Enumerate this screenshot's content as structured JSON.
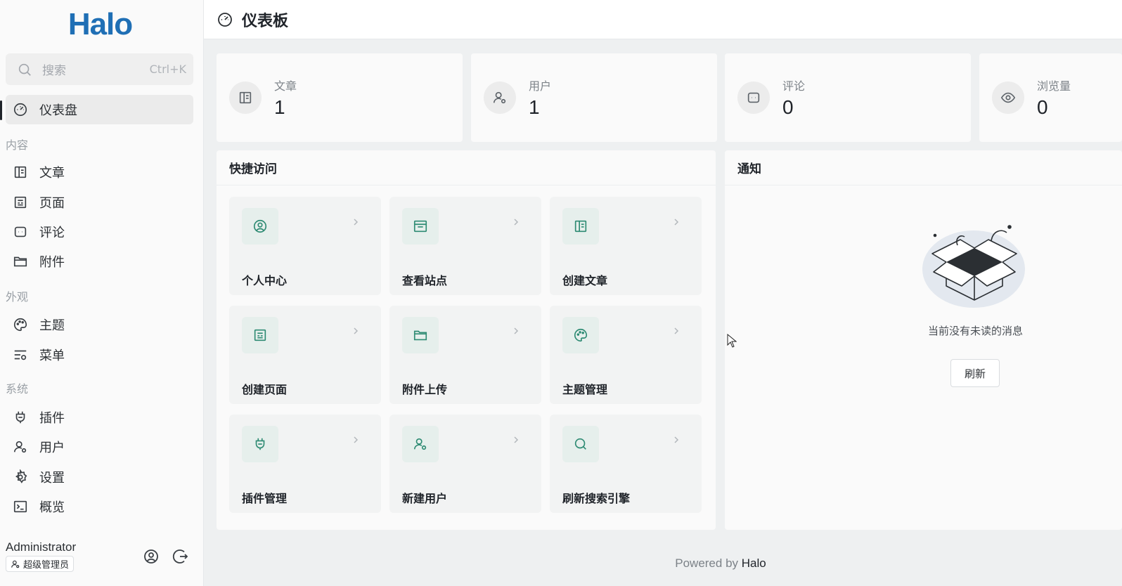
{
  "app": {
    "logo": "Halo"
  },
  "search": {
    "placeholder": "搜索",
    "shortcut": "Ctrl+K"
  },
  "sidebar": {
    "dashboard": {
      "label": "仪表盘",
      "icon": "dashboard-icon"
    },
    "sections": {
      "content": "内容",
      "appearance": "外观",
      "system": "系统"
    },
    "items": [
      {
        "label": "文章",
        "icon": "posts-icon"
      },
      {
        "label": "页面",
        "icon": "pages-icon"
      },
      {
        "label": "评论",
        "icon": "comments-icon"
      },
      {
        "label": "附件",
        "icon": "folder-icon"
      },
      {
        "label": "主题",
        "icon": "palette-icon"
      },
      {
        "label": "菜单",
        "icon": "menu-settings-icon"
      },
      {
        "label": "插件",
        "icon": "plug-icon"
      },
      {
        "label": "用户",
        "icon": "user-icon"
      },
      {
        "label": "设置",
        "icon": "gear-icon"
      },
      {
        "label": "概览",
        "icon": "terminal-icon"
      }
    ],
    "user": {
      "name": "Administrator",
      "role": "超级管理员"
    }
  },
  "header": {
    "title": "仪表板"
  },
  "stats": [
    {
      "label": "文章",
      "value": "1",
      "icon": "posts-icon"
    },
    {
      "label": "用户",
      "value": "1",
      "icon": "user-icon"
    },
    {
      "label": "评论",
      "value": "0",
      "icon": "comments-icon"
    },
    {
      "label": "浏览量",
      "value": "0",
      "icon": "eye-icon"
    }
  ],
  "quick_access": {
    "title": "快捷访问",
    "tiles": [
      {
        "label": "个人中心",
        "icon": "user-circle-icon"
      },
      {
        "label": "查看站点",
        "icon": "browser-window-icon"
      },
      {
        "label": "创建文章",
        "icon": "posts-icon"
      },
      {
        "label": "创建页面",
        "icon": "pages-icon"
      },
      {
        "label": "附件上传",
        "icon": "folder-icon"
      },
      {
        "label": "主题管理",
        "icon": "palette-icon"
      },
      {
        "label": "插件管理",
        "icon": "plug-icon"
      },
      {
        "label": "新建用户",
        "icon": "user-icon"
      },
      {
        "label": "刷新搜索引擎",
        "icon": "search-icon"
      }
    ]
  },
  "notifications": {
    "title": "通知",
    "empty_text": "当前没有未读的消息",
    "refresh_label": "刷新"
  },
  "footer": {
    "powered_prefix": "Powered by",
    "powered_brand": "Halo"
  },
  "colors": {
    "accent": "#2e8b73",
    "logo": "#1f6fb5"
  }
}
